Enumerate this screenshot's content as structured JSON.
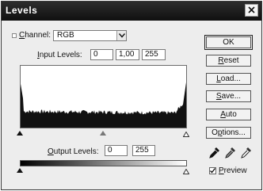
{
  "window": {
    "title": "Levels"
  },
  "channel": {
    "label": "Channel:",
    "value": "RGB"
  },
  "input_levels": {
    "label": "Input Levels:",
    "black": "0",
    "gamma": "1,00",
    "white": "255"
  },
  "output_levels": {
    "label": "Output Levels:",
    "black": "0",
    "white": "255"
  },
  "buttons": {
    "ok": "OK",
    "reset": "Reset",
    "load": "Load...",
    "save": "Save...",
    "auto": "Auto",
    "options": "Options..."
  },
  "preview": {
    "label": "Preview",
    "checked": true
  },
  "icons": {
    "close": "close-icon",
    "dropdown": "chevron-down-icon",
    "eyedroppers": [
      "black-point-eyedropper-icon",
      "gray-point-eyedropper-icon",
      "white-point-eyedropper-icon"
    ]
  },
  "colors": {
    "titlebar": "#1a1a1a",
    "dialog_bg": "#ededed",
    "histogram": "#111111"
  }
}
